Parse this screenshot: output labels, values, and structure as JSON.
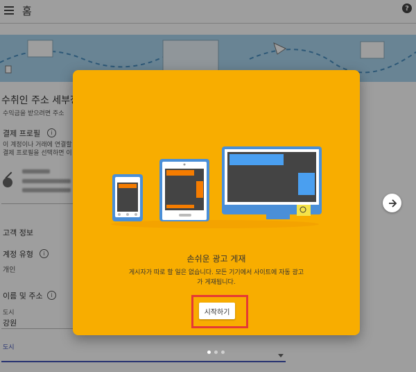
{
  "header": {
    "title": "홈"
  },
  "banner": {
    "background": "#aad6ef"
  },
  "background_page": {
    "section_title": "수취인 주소 세부정",
    "section_sub": "수익금을 받으려면 주소",
    "payment_profile_label": "결제 프로필",
    "payment_profile_desc1": "이 계정이나 거래에 연결할 결",
    "payment_profile_desc2": "결제 프로필을 선택하면 이 결",
    "customer_info": "고객 정보",
    "account_type_label": "계정 유형",
    "account_type_value": "개인",
    "name_address_label": "이름 및 주소",
    "city_small_label": "도시",
    "city_value": "강원",
    "city_field_label": "도시"
  },
  "modal": {
    "accent": "#f8ad00",
    "title": "손쉬운 광고 게재",
    "description": "게시자가 따로 할 일은 없습니다. 모든 기기에서 사이트에 자동 광고가 게재됩니다.",
    "start_label": "시작하기",
    "highlight_color": "#e53935"
  },
  "pagination": {
    "total": 3,
    "active": 1
  },
  "icons": {
    "menu": "menu-icon",
    "help": "help-icon",
    "next": "arrow-right-icon",
    "back": "chevron-left-icon",
    "person": "person-icon"
  }
}
